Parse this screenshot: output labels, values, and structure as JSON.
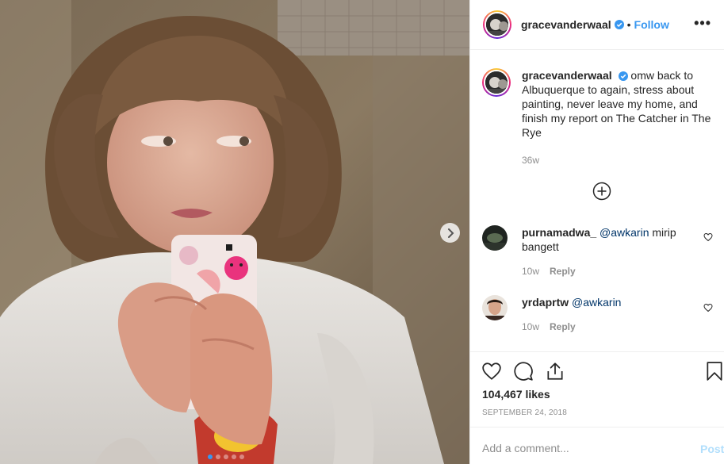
{
  "header": {
    "username": "gracevanderwaal",
    "separator": "•",
    "follow_label": "Follow",
    "more_label": "•••"
  },
  "caption": {
    "username": "gracevanderwaal",
    "text": "omw back to Albuquerque to again, stress about painting, never leave my home, and finish my report on The Catcher in The Rye",
    "time": "36w"
  },
  "comments": [
    {
      "username": "purnamadwa_",
      "mention": "@awkarin",
      "text": " mirip bangett",
      "time": "10w",
      "reply_label": "Reply"
    },
    {
      "username": "yrdaprtw",
      "mention": "@awkarin",
      "text": "",
      "time": "10w",
      "reply_label": "Reply"
    }
  ],
  "stats": {
    "likes": "104,467 likes",
    "date": "SEPTEMBER 24, 2018"
  },
  "add_comment": {
    "placeholder": "Add a comment...",
    "post_label": "Post"
  },
  "carousel": {
    "count": 5,
    "active_index": 0
  },
  "colors": {
    "accent": "#3897f0",
    "mention": "#003569",
    "muted": "#8e8e8e",
    "post_disabled": "#b2dffc"
  }
}
